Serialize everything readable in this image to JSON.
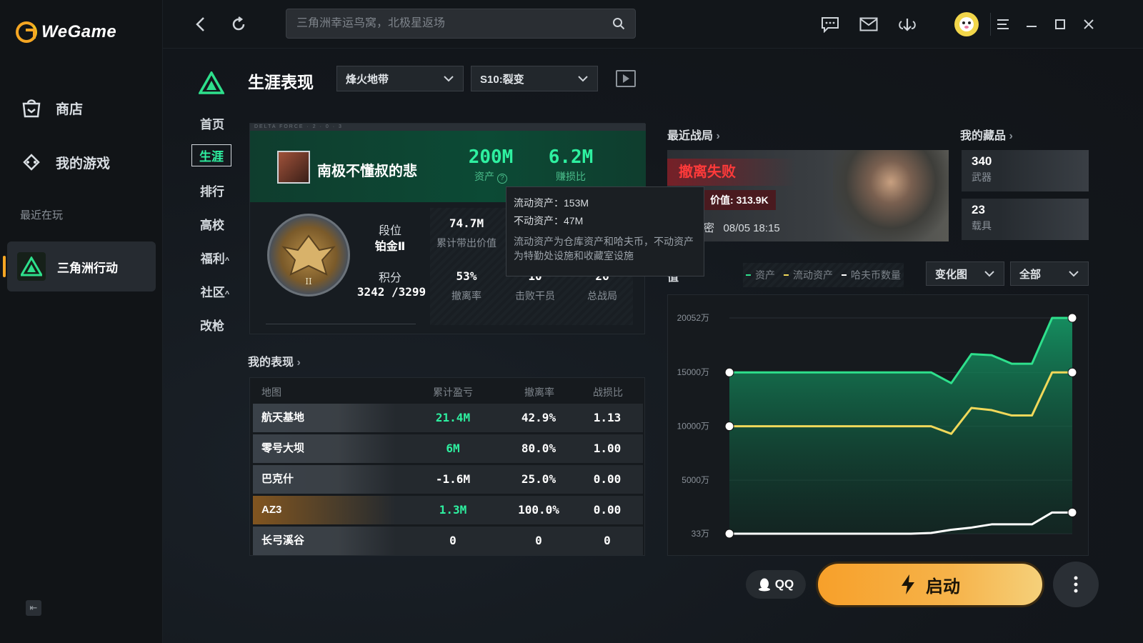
{
  "app": {
    "brand": "WeGame",
    "nav": [
      {
        "label": "商店",
        "icon": "store-icon"
      },
      {
        "label": "我的游戏",
        "icon": "gamepad-icon"
      }
    ],
    "recent_label": "最近在玩",
    "recent_game": "三角洲行动"
  },
  "topbar": {
    "search_placeholder": "三角洲幸运鸟窝，北极星返场"
  },
  "game_nav": {
    "items": [
      "首页",
      "生涯",
      "排行",
      "高校",
      "福利",
      "社区",
      "改枪"
    ],
    "active": "生涯"
  },
  "header": {
    "title": "生涯表现",
    "mode_select": "烽火地带",
    "season_select": "S10:裂变"
  },
  "player": {
    "strip_text": "DELTA FORCE · 2 · 0 · 3",
    "name": "南极不懂叔的悲",
    "asset_value": "200M",
    "asset_label": "资产",
    "ratio_value": "6.2M",
    "ratio_label": "赚损比",
    "rank_label": "段位",
    "rank_value": "铂金Ⅱ",
    "points_label": "积分",
    "points_value": "3242 /3299",
    "stats": [
      {
        "value": "74.7M",
        "label": "累计带出价值"
      },
      {
        "value": "53%",
        "label": "撤离率"
      },
      {
        "value": "10",
        "label": "击败干员"
      },
      {
        "value": "26",
        "label": "总战局"
      }
    ]
  },
  "tooltip": {
    "liquid": "流动资产：153M",
    "fixed": "不动资产：47M",
    "desc": "流动资产为仓库资产和哈夫币，不动资产为特勤处设施和收藏室设施"
  },
  "performance": {
    "title": "我的表现",
    "columns": [
      "地图",
      "累计盈亏",
      "撤离率",
      "战损比"
    ],
    "rows": [
      {
        "map": "航天基地",
        "pnl": "21.4M",
        "rate": "42.9%",
        "kd": "1.13",
        "positive": true
      },
      {
        "map": "零号大坝",
        "pnl": "6M",
        "rate": "80.0%",
        "kd": "1.00",
        "positive": true
      },
      {
        "map": "巴克什",
        "pnl": "-1.6M",
        "rate": "25.0%",
        "kd": "0.00",
        "positive": false
      },
      {
        "map": "AZ3",
        "pnl": "1.3M",
        "rate": "100.0%",
        "kd": "0.00",
        "positive": true
      },
      {
        "map": "长弓溪谷",
        "pnl": "0",
        "rate": "0",
        "kd": "0",
        "positive": false
      }
    ]
  },
  "recent_battle": {
    "title": "最近战局",
    "result": "撤离失败",
    "value_label": "价值:",
    "value": "313.9K",
    "mode": "十-绝密",
    "time": "08/05 18:15"
  },
  "collection": {
    "title": "我的藏品",
    "items": [
      {
        "value": "340",
        "label": "武器"
      },
      {
        "value": "23",
        "label": "载具"
      }
    ]
  },
  "asset_chart": {
    "label": "值",
    "legend": [
      {
        "name": "资产",
        "color": "#2ee08c"
      },
      {
        "name": "流动资产",
        "color": "#f0d85a"
      },
      {
        "name": "哈夫币数量",
        "color": "#ffffff"
      }
    ],
    "view_select": "变化图",
    "range_select": "全部"
  },
  "chart_data": {
    "type": "line",
    "ytick_labels": [
      "20052万",
      "15000万",
      "10000万",
      "5000万",
      "33万"
    ],
    "ytick_values": [
      20052,
      15000,
      10000,
      5000,
      33
    ],
    "ylim": [
      33,
      20052
    ],
    "x": [
      0,
      1,
      2,
      3,
      4,
      5,
      6,
      7,
      8,
      9,
      10,
      11,
      12,
      13,
      14,
      15,
      16,
      17
    ],
    "series": [
      {
        "name": "资产",
        "color": "#2ee08c",
        "values": [
          15000,
          15000,
          15000,
          15000,
          15000,
          15000,
          15000,
          15000,
          15000,
          15000,
          15000,
          14000,
          16700,
          16600,
          15800,
          15800,
          20052,
          20052
        ]
      },
      {
        "name": "流动资产",
        "color": "#f0d85a",
        "values": [
          10000,
          10000,
          10000,
          10000,
          10000,
          10000,
          10000,
          10000,
          10000,
          10000,
          10000,
          9300,
          11700,
          11500,
          11000,
          11000,
          15000,
          15000
        ]
      },
      {
        "name": "哈夫币数量",
        "color": "#ffffff",
        "values": [
          33,
          33,
          33,
          33,
          33,
          33,
          33,
          33,
          33,
          33,
          100,
          400,
          600,
          900,
          900,
          900,
          2000,
          2000
        ]
      }
    ]
  },
  "footer": {
    "qq": "QQ",
    "launch": "启动"
  }
}
